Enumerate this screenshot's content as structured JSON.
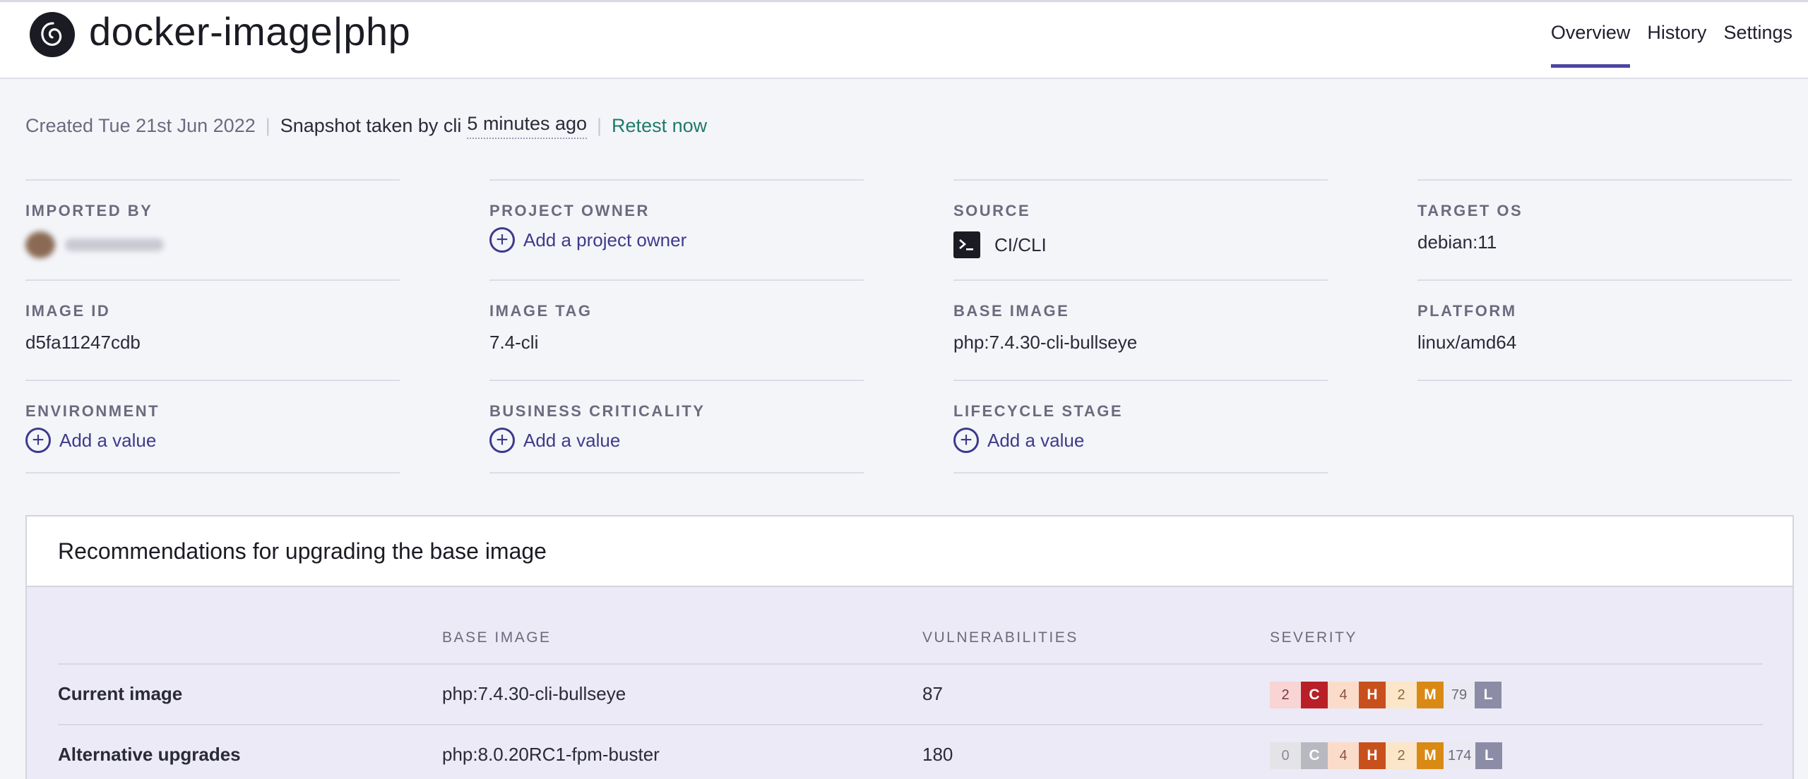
{
  "header": {
    "title": "docker-image|php",
    "tabs": [
      {
        "label": "Overview",
        "active": true
      },
      {
        "label": "History",
        "active": false
      },
      {
        "label": "Settings",
        "active": false
      }
    ]
  },
  "meta": {
    "created": "Created Tue 21st Jun 2022",
    "snapshot_prefix": "Snapshot taken by cli",
    "snapshot_time": "5 minutes ago",
    "retest": "Retest now"
  },
  "fields": {
    "imported_by": {
      "label": "IMPORTED BY"
    },
    "project_owner": {
      "label": "PROJECT OWNER",
      "action": "Add a project owner"
    },
    "source": {
      "label": "SOURCE",
      "value": "CI/CLI",
      "icon": "terminal-icon"
    },
    "target_os": {
      "label": "TARGET OS",
      "value": "debian:11"
    },
    "image_id": {
      "label": "IMAGE ID",
      "value": "d5fa11247cdb"
    },
    "image_tag": {
      "label": "IMAGE TAG",
      "value": "7.4-cli"
    },
    "base_image": {
      "label": "BASE IMAGE",
      "value": "php:7.4.30-cli-bullseye"
    },
    "platform": {
      "label": "PLATFORM",
      "value": "linux/amd64"
    },
    "environment": {
      "label": "ENVIRONMENT",
      "action": "Add a value"
    },
    "business_criticality": {
      "label": "BUSINESS CRITICALITY",
      "action": "Add a value"
    },
    "lifecycle_stage": {
      "label": "LIFECYCLE STAGE",
      "action": "Add a value"
    }
  },
  "recommendations": {
    "title": "Recommendations for upgrading the base image",
    "columns": {
      "base_image": "BASE IMAGE",
      "vulnerabilities": "VULNERABILITIES",
      "severity": "SEVERITY"
    },
    "rows": [
      {
        "label": "Current image",
        "base_image": "php:7.4.30-cli-bullseye",
        "vulnerabilities": "87",
        "severity": {
          "critical": "2",
          "high": "4",
          "medium": "2",
          "low": "79"
        }
      },
      {
        "label": "Alternative upgrades",
        "base_image": "php:8.0.20RC1-fpm-buster",
        "vulnerabilities": "180",
        "severity": {
          "critical": "0",
          "high": "4",
          "medium": "2",
          "low": "174"
        }
      }
    ],
    "badges": {
      "critical": "C",
      "high": "H",
      "medium": "M",
      "low": "L"
    }
  },
  "colors": {
    "accent": "#4b45a1",
    "link": "#1f7a6a",
    "critical": "#b81f26",
    "high": "#c8501c",
    "medium": "#d98a14",
    "low": "#8c8ca6"
  }
}
